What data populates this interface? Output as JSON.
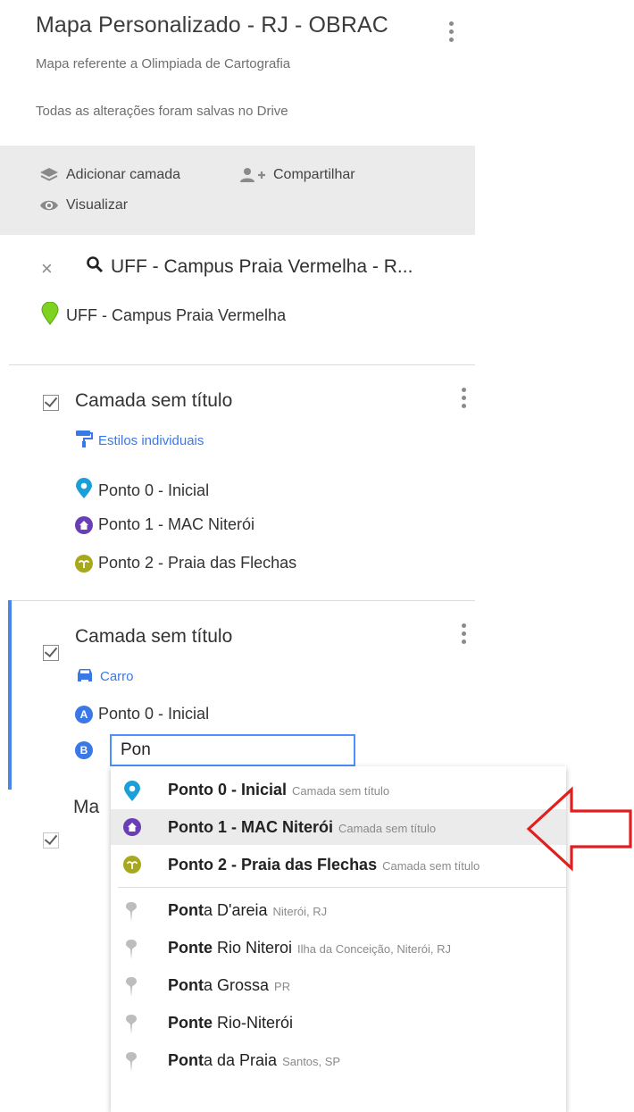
{
  "header": {
    "title": "Mapa Personalizado - RJ - OBRAC",
    "subtitle": "Mapa referente a Olimpiada de Cartografia",
    "save_status": "Todas as alterações foram salvas no Drive"
  },
  "toolbar": {
    "add_layer": "Adicionar camada",
    "share": "Compartilhar",
    "preview": "Visualizar"
  },
  "search": {
    "query": "UFF - Campus Praia Vermelha - R...",
    "result": "UFF - Campus Praia Vermelha"
  },
  "layer1": {
    "title": "Camada sem título",
    "style": "Estilos individuais",
    "items": [
      "Ponto 0 - Inicial",
      "Ponto 1 - MAC Niterói",
      "Ponto 2 - Praia das Flechas"
    ]
  },
  "layer2": {
    "title": "Camada sem título",
    "mode": "Carro",
    "origin_letter": "A",
    "origin": "Ponto 0 - Inicial",
    "dest_letter": "B",
    "dest_value": "Pon"
  },
  "below_text": "Ma",
  "suggestions": [
    {
      "bold": "Ponto 0 - Inicial",
      "rest": "",
      "sub": "Camada sem título",
      "icon": "blue-pin-icon"
    },
    {
      "bold": "Ponto 1 - MAC Niterói",
      "rest": "",
      "sub": "Camada sem título",
      "icon": "purple-house-icon"
    },
    {
      "bold": "Ponto 2 - Praia das Flechas",
      "rest": "",
      "sub": "Camada sem título",
      "icon": "olive-palm-icon"
    },
    {
      "bold": "Pont",
      "rest": "a D'areia",
      "sub": "Niterói, RJ",
      "icon": "gray-pin-icon"
    },
    {
      "bold": "Ponte",
      "rest": " Rio Niteroi",
      "sub": "Ilha da Conceição, Niterói, RJ",
      "icon": "gray-pin-icon"
    },
    {
      "bold": "Pont",
      "rest": "a Grossa",
      "sub": "PR",
      "icon": "gray-pin-icon"
    },
    {
      "bold": "Ponte",
      "rest": " Rio-Niterói",
      "sub": "",
      "icon": "gray-pin-icon"
    },
    {
      "bold": "Pont",
      "rest": "a da Praia",
      "sub": "Santos, SP",
      "icon": "gray-pin-icon"
    }
  ],
  "colors": {
    "accent": "#4a86e8",
    "link": "#3b78e7",
    "arrow": "#e02020",
    "pin_blue": "#1a9fd9",
    "house_purple": "#6a3fb5",
    "palm_olive": "#a8a81e",
    "pin_green": "#7ed321"
  }
}
